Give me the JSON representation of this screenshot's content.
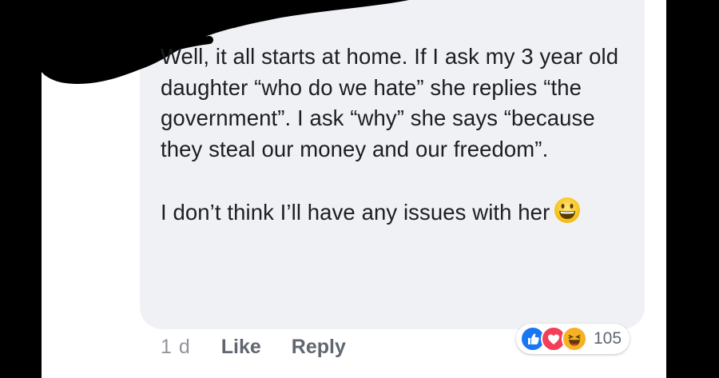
{
  "comment": {
    "paragraphs": [
      "Well, it all starts at home. If I ask my 3 year old daughter “who do we hate” she replies “the government”. I ask “why” she says “because they steal our money and our freedom”.",
      "I don’t think I’ll have any issues with her"
    ],
    "emoji": "grinning-face-emoji"
  },
  "meta": {
    "time": "1 d",
    "like_label": "Like",
    "reply_label": "Reply"
  },
  "reactions": {
    "icons": [
      "like-reaction-icon",
      "love-reaction-icon",
      "haha-reaction-icon"
    ],
    "count": "105"
  },
  "colors": {
    "bubble": "#f0f1f4",
    "text": "#1c1e21",
    "meta": "#606770",
    "like_blue": "#1877f2",
    "love_red": "#f33e58",
    "haha_yellow": "#f7b125"
  }
}
